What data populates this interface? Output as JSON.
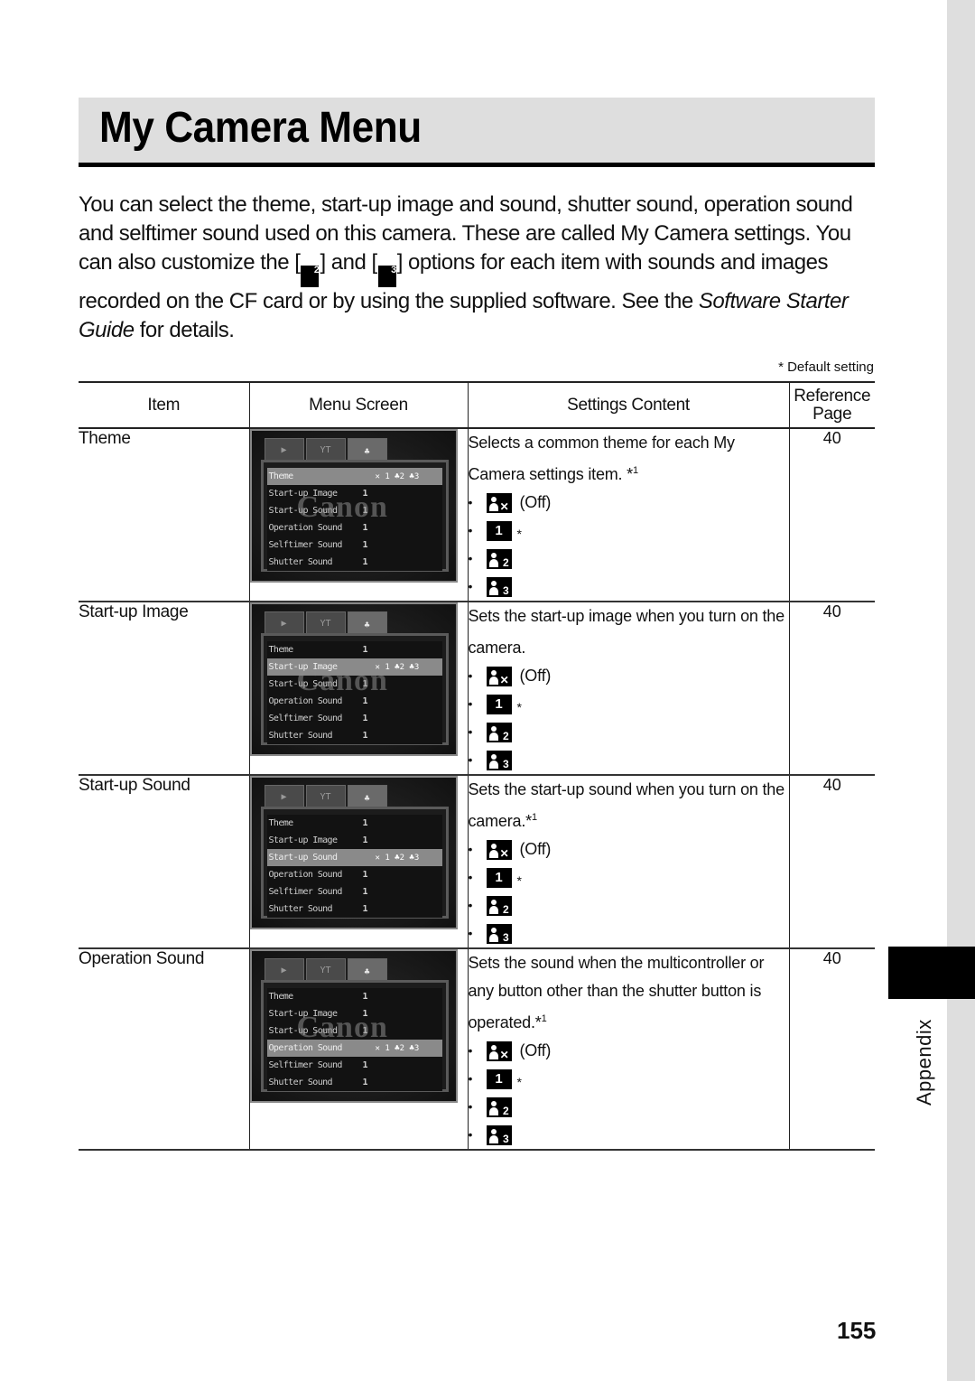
{
  "title": "My Camera Menu",
  "intro": {
    "part1": "You can select the theme, start-up image and sound, shutter sound, operation sound and selftimer sound used on this camera. These are called My Camera settings. You can also customize the [",
    "icon_a": "2",
    "part2": "] and [",
    "icon_b": "3",
    "part3": "] options for each item with sounds and images recorded on the CF card or by using the supplied software. See the ",
    "guide_title": "Software Starter Guide",
    "part4": " for details."
  },
  "default_note": "* Default setting",
  "table": {
    "headers": {
      "item": "Item",
      "menu_screen": "Menu Screen",
      "settings_content": "Settings Content",
      "reference_line1": "Reference",
      "reference_line2": "Page"
    },
    "option_labels": {
      "off": "(Off)",
      "default_marker": "*",
      "one": "1",
      "two": "2",
      "three": "3"
    },
    "lcd": {
      "tab1": "▶",
      "tab2": "YT",
      "tab3": "♣",
      "watermark": "Canon",
      "menu_items": [
        "Theme",
        "Start-up Image",
        "Start-up Sound",
        "Operation Sound",
        "Selftimer Sound",
        "Shutter Sound"
      ],
      "value": "1",
      "selected_extra": "✕ 1 ♣2 ♣3"
    },
    "rows": [
      {
        "item": "Theme",
        "desc": "Selects a common theme for each My Camera settings item. *",
        "footnote": "1",
        "ref": "40",
        "selected_menu": "Theme"
      },
      {
        "item": "Start-up Image",
        "desc": "Sets the start-up image when you turn on the camera.",
        "footnote": "",
        "ref": "40",
        "selected_menu": "Start-up Image"
      },
      {
        "item": "Start-up Sound",
        "desc": "Sets the start-up sound when you turn on the camera.*",
        "footnote": "1",
        "ref": "40",
        "selected_menu": "Start-up Sound"
      },
      {
        "item": "Operation Sound",
        "desc": "Sets the sound when the multicontroller or any button other than the shutter button is operated.*",
        "footnote": "1",
        "ref": "40",
        "selected_menu": "Operation Sound"
      }
    ]
  },
  "side_tab": {
    "label": "Appendix"
  },
  "page_number": "155"
}
